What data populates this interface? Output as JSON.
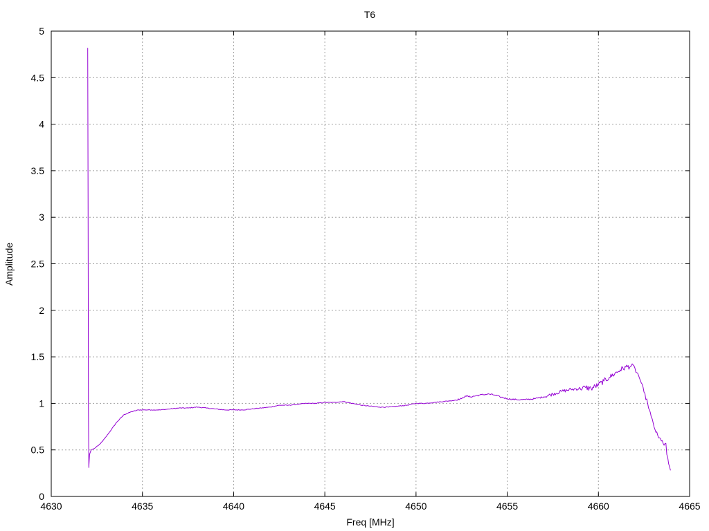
{
  "chart_data": {
    "type": "line",
    "title": "T6",
    "xlabel": "Freq [MHz]",
    "ylabel": "Amplitude",
    "xlim": [
      4630,
      4665
    ],
    "ylim": [
      0,
      5
    ],
    "xticks": [
      "4630",
      "4635",
      "4640",
      "4645",
      "4650",
      "4655",
      "4660",
      "4665"
    ],
    "yticks": [
      "0",
      "0.5",
      "1",
      "1.5",
      "2",
      "2.5",
      "3",
      "3.5",
      "4",
      "4.5",
      "5"
    ],
    "grid": true,
    "legend": "none",
    "series": [
      {
        "color": "#9400d3",
        "x": [
          4632.0,
          4632.02,
          4632.04,
          4632.06,
          4632.08,
          4632.1,
          4632.15,
          4632.2,
          4632.3,
          4632.4,
          4632.6,
          4632.8,
          4633.0,
          4633.3,
          4633.6,
          4634.0,
          4634.4,
          4634.8,
          4635.0,
          4635.5,
          4636.0,
          4636.5,
          4637.0,
          4637.5,
          4638.0,
          4638.5,
          4639.0,
          4639.5,
          4640.0,
          4640.5,
          4641.0,
          4641.5,
          4642.0,
          4642.5,
          4643.0,
          4643.5,
          4644.0,
          4644.5,
          4645.0,
          4645.5,
          4646.0,
          4646.5,
          4647.0,
          4647.5,
          4648.0,
          4648.5,
          4649.0,
          4649.5,
          4650.0,
          4650.5,
          4651.0,
          4651.5,
          4652.0,
          4652.5,
          4652.7,
          4653.0,
          4653.5,
          4654.0,
          4654.3,
          4654.6,
          4655.0,
          4655.5,
          4656.0,
          4656.5,
          4657.0,
          4657.5,
          4658.0,
          4658.5,
          4659.0,
          4659.3,
          4659.6,
          4660.0,
          4660.3,
          4660.6,
          4660.9,
          4661.2,
          4661.5,
          4661.8,
          4662.0,
          4662.1,
          4662.2,
          4662.35,
          4662.5,
          4662.7,
          4662.9,
          4663.1,
          4663.3,
          4663.5,
          4663.6,
          4663.7,
          4663.75,
          4663.85,
          4663.95
        ],
        "y": [
          4.82,
          3.2,
          0.95,
          0.31,
          0.38,
          0.45,
          0.48,
          0.5,
          0.51,
          0.52,
          0.55,
          0.59,
          0.64,
          0.72,
          0.8,
          0.88,
          0.91,
          0.93,
          0.93,
          0.93,
          0.93,
          0.94,
          0.95,
          0.95,
          0.96,
          0.95,
          0.94,
          0.93,
          0.93,
          0.93,
          0.94,
          0.95,
          0.96,
          0.98,
          0.98,
          0.99,
          1.0,
          1.0,
          1.01,
          1.01,
          1.02,
          1.0,
          0.98,
          0.97,
          0.96,
          0.96,
          0.97,
          0.98,
          1.0,
          1.0,
          1.01,
          1.02,
          1.03,
          1.05,
          1.08,
          1.07,
          1.09,
          1.1,
          1.09,
          1.07,
          1.05,
          1.04,
          1.04,
          1.05,
          1.07,
          1.1,
          1.13,
          1.15,
          1.16,
          1.17,
          1.16,
          1.2,
          1.24,
          1.28,
          1.32,
          1.36,
          1.39,
          1.4,
          1.38,
          1.33,
          1.3,
          1.22,
          1.12,
          1.0,
          0.85,
          0.72,
          0.63,
          0.6,
          0.55,
          0.57,
          0.45,
          0.35,
          0.28
        ]
      }
    ]
  }
}
